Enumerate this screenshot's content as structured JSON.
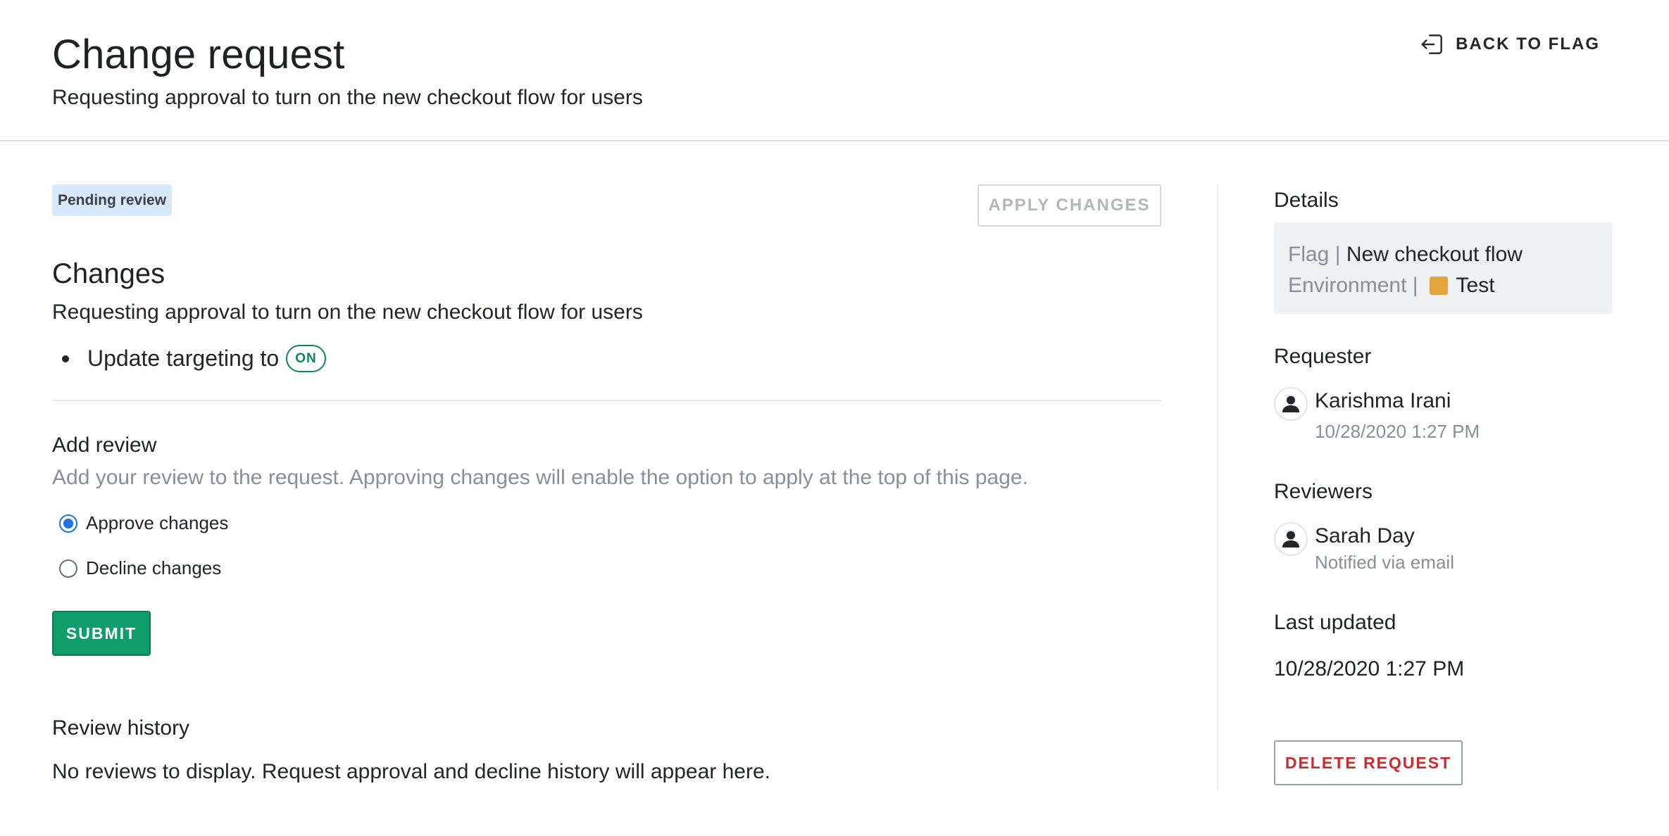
{
  "header": {
    "title": "Change request",
    "subtitle": "Requesting approval to turn on the new checkout flow for users",
    "back_label": "BACK TO FLAG"
  },
  "main": {
    "status_badge": "Pending review",
    "apply_label": "APPLY CHANGES",
    "changes_title": "Changes",
    "changes_description": "Requesting approval to turn on the new checkout flow for users",
    "change_items": [
      {
        "text": "Update targeting to",
        "pill": "ON"
      }
    ],
    "review": {
      "title": "Add review",
      "description": "Add your review to the request. Approving changes will enable the option to apply at the top of this page.",
      "options": [
        {
          "label": "Approve changes",
          "selected": true
        },
        {
          "label": "Decline changes",
          "selected": false
        }
      ],
      "submit_label": "SUBMIT"
    },
    "history": {
      "title": "Review history",
      "empty_text": "No reviews to display. Request approval and decline history will appear here."
    }
  },
  "sidebar": {
    "details_label": "Details",
    "flag_key": "Flag |",
    "flag_value": "New checkout flow",
    "environment_key": "Environment |",
    "environment_value": "Test",
    "environment_color": "#e3a53b",
    "requester_label": "Requester",
    "requester": {
      "name": "Karishma Irani",
      "sub": "10/28/2020 1:27 PM"
    },
    "reviewers_label": "Reviewers",
    "reviewers": [
      {
        "name": "Sarah Day",
        "sub": "Notified via email"
      }
    ],
    "last_updated_label": "Last updated",
    "last_updated_value": "10/28/2020 1:27 PM",
    "delete_label": "DELETE REQUEST"
  },
  "colors": {
    "submit": "#0f9d6b",
    "on_pill": "#11865b",
    "delete_text": "#cc2b2b",
    "badge_bg": "#d7e9fb",
    "radio_accent": "#1a73e8"
  }
}
